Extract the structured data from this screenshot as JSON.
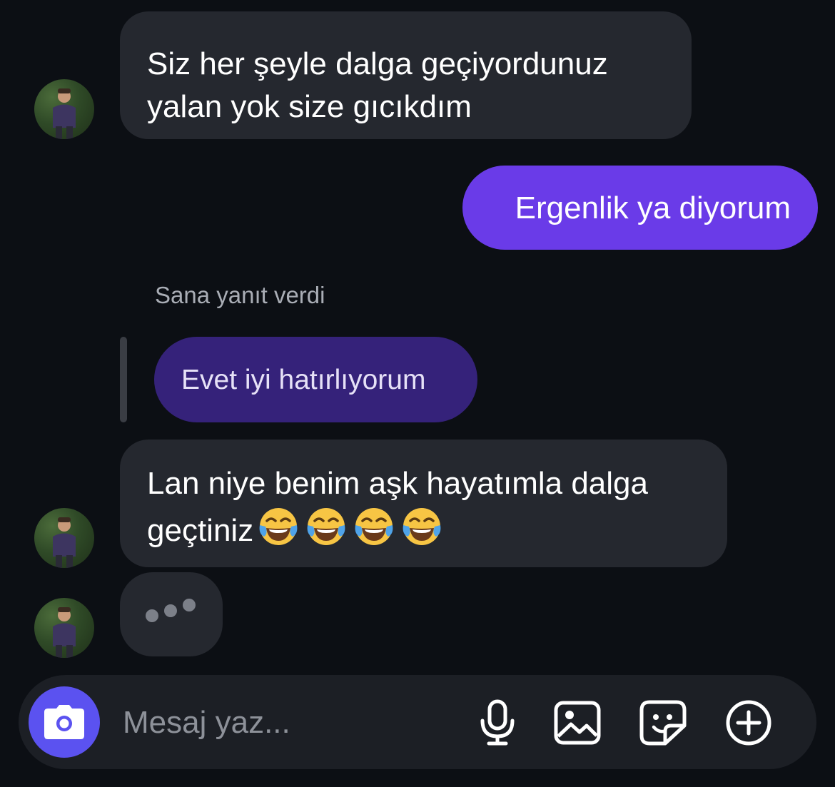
{
  "messages": [
    {
      "id": "m1",
      "sender": "other",
      "text": "Siz her şeyle dalga geçiyordunuz\nyalan yok size gıcıkdım"
    },
    {
      "id": "m2",
      "sender": "me",
      "text": "Ergenlik ya diyorum"
    },
    {
      "id": "m3",
      "sender": "other",
      "reply_label": "Sana yanıt verdi",
      "quoted_text": "Evet iyi hatırlıyorum"
    },
    {
      "id": "m4",
      "sender": "other",
      "text": "Lan niye benim aşk hayatımla dalga\ngeçtiniz",
      "emoji_count": 4,
      "emoji": "face-with-tears-of-joy"
    }
  ],
  "typing_indicator": {
    "visible": true
  },
  "composer": {
    "placeholder": "Mesaj yaz...",
    "icons": [
      "camera-icon",
      "microphone-icon",
      "image-icon",
      "sticker-icon",
      "plus-circle-icon"
    ]
  },
  "colors": {
    "background": "#0c0f14",
    "incoming_bubble": "#25282f",
    "outgoing_bubble": "#6a3be8",
    "quoted_bubble": "#35227a",
    "camera_button": "#5b52f0",
    "composer": "#1c1f25"
  }
}
